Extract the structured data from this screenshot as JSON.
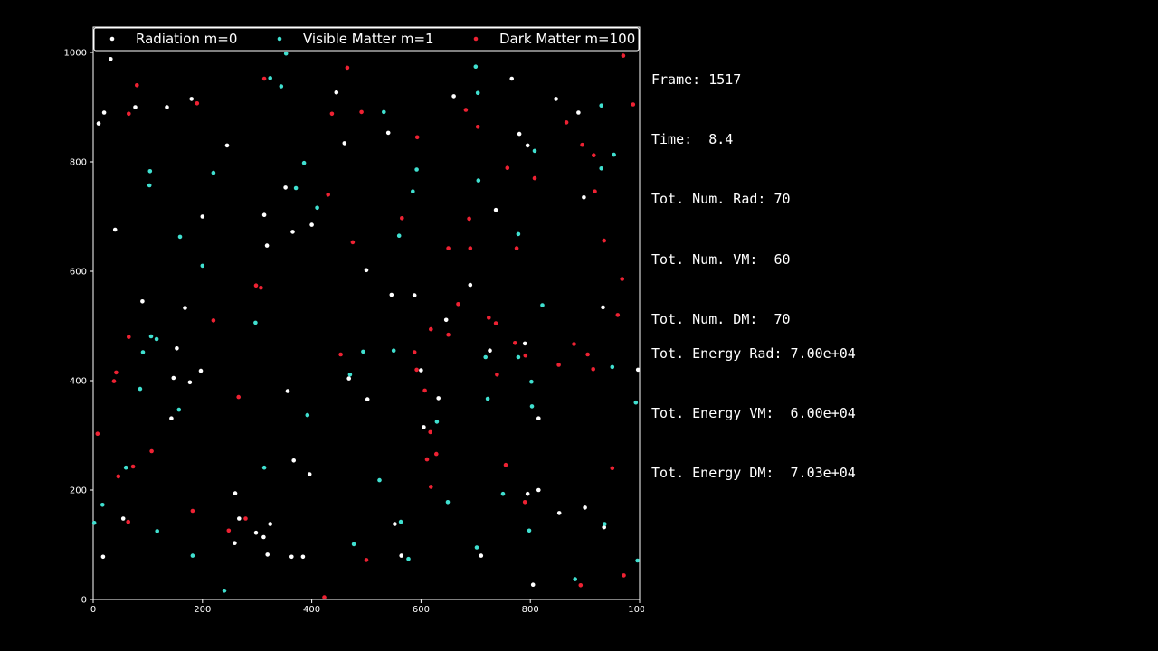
{
  "stats": {
    "frame": "Frame: 1517",
    "time": "Time:  8.4",
    "rad": "Tot. Num. Rad: 70",
    "vm": "Tot. Num. VM:  60",
    "dm": "Tot. Num. DM:  70",
    "energy_rad": "Tot. Energy Rad: 7.00e+04",
    "energy_vm": "Tot. Energy VM:  6.00e+04",
    "energy_dm": "Tot. Energy DM:  7.03e+04"
  },
  "chart_data": {
    "type": "scatter",
    "xlim": [
      0,
      1000
    ],
    "ylim": [
      0,
      1000
    ],
    "xticks": [
      0,
      200,
      400,
      600,
      800,
      1000
    ],
    "yticks": [
      0,
      200,
      400,
      600,
      800,
      1000
    ],
    "grid": false,
    "legend_position": "top",
    "series": [
      {
        "name": "Radiation m=0",
        "color": "#ffffff",
        "points": [
          [
            10,
            870
          ],
          [
            20,
            890
          ],
          [
            32,
            988
          ],
          [
            40,
            676
          ],
          [
            55,
            148
          ],
          [
            18,
            78
          ],
          [
            77,
            900
          ],
          [
            90,
            545
          ],
          [
            135,
            900
          ],
          [
            180,
            915
          ],
          [
            200,
            700
          ],
          [
            245,
            830
          ],
          [
            313,
            703
          ],
          [
            318,
            647
          ],
          [
            352,
            753
          ],
          [
            365,
            672
          ],
          [
            400,
            685
          ],
          [
            445,
            927
          ],
          [
            460,
            834
          ],
          [
            540,
            853
          ],
          [
            500,
            602
          ],
          [
            546,
            557
          ],
          [
            588,
            556
          ],
          [
            660,
            920
          ],
          [
            690,
            575
          ],
          [
            737,
            712
          ],
          [
            766,
            952
          ],
          [
            780,
            851
          ],
          [
            795,
            830
          ],
          [
            847,
            915
          ],
          [
            888,
            890
          ],
          [
            898,
            735
          ],
          [
            168,
            533
          ],
          [
            153,
            459
          ],
          [
            147,
            405
          ],
          [
            177,
            397
          ],
          [
            197,
            418
          ],
          [
            143,
            331
          ],
          [
            356,
            381
          ],
          [
            468,
            404
          ],
          [
            502,
            366
          ],
          [
            600,
            419
          ],
          [
            605,
            315
          ],
          [
            632,
            368
          ],
          [
            646,
            511
          ],
          [
            726,
            455
          ],
          [
            790,
            468
          ],
          [
            815,
            331
          ],
          [
            260,
            194
          ],
          [
            259,
            103
          ],
          [
            267,
            148
          ],
          [
            298,
            122
          ],
          [
            312,
            114
          ],
          [
            324,
            138
          ],
          [
            367,
            254
          ],
          [
            396,
            229
          ],
          [
            319,
            82
          ],
          [
            363,
            78
          ],
          [
            384,
            78
          ],
          [
            552,
            138
          ],
          [
            564,
            80
          ],
          [
            710,
            80
          ],
          [
            795,
            193
          ],
          [
            815,
            200
          ],
          [
            853,
            158
          ],
          [
            900,
            168
          ],
          [
            933,
            534
          ],
          [
            935,
            132
          ],
          [
            997,
            420
          ],
          [
            805,
            27
          ]
        ]
      },
      {
        "name": "Visible Matter m=1",
        "color": "#40e0d0",
        "points": [
          [
            2,
            140
          ],
          [
            17,
            173
          ],
          [
            60,
            241
          ],
          [
            86,
            385
          ],
          [
            91,
            452
          ],
          [
            104,
            783
          ],
          [
            103,
            757
          ],
          [
            106,
            481
          ],
          [
            116,
            476
          ],
          [
            117,
            125
          ],
          [
            157,
            347
          ],
          [
            159,
            663
          ],
          [
            182,
            80
          ],
          [
            200,
            610
          ],
          [
            220,
            780
          ],
          [
            240,
            16
          ],
          [
            297,
            506
          ],
          [
            313,
            241
          ],
          [
            324,
            953
          ],
          [
            344,
            938
          ],
          [
            353,
            998
          ],
          [
            371,
            752
          ],
          [
            386,
            798
          ],
          [
            392,
            337
          ],
          [
            410,
            716
          ],
          [
            470,
            411
          ],
          [
            477,
            101
          ],
          [
            494,
            453
          ],
          [
            524,
            218
          ],
          [
            532,
            891
          ],
          [
            550,
            455
          ],
          [
            560,
            665
          ],
          [
            563,
            142
          ],
          [
            577,
            74
          ],
          [
            585,
            746
          ],
          [
            592,
            786
          ],
          [
            629,
            325
          ],
          [
            649,
            178
          ],
          [
            700,
            974
          ],
          [
            704,
            926
          ],
          [
            702,
            95
          ],
          [
            705,
            766
          ],
          [
            718,
            443
          ],
          [
            722,
            367
          ],
          [
            750,
            193
          ],
          [
            778,
            668
          ],
          [
            778,
            443
          ],
          [
            798,
            126
          ],
          [
            802,
            398
          ],
          [
            803,
            353
          ],
          [
            808,
            820
          ],
          [
            822,
            538
          ],
          [
            882,
            37
          ],
          [
            930,
            903
          ],
          [
            930,
            788
          ],
          [
            936,
            138
          ],
          [
            950,
            425
          ],
          [
            953,
            813
          ],
          [
            993,
            360
          ],
          [
            996,
            71
          ]
        ]
      },
      {
        "name": "Dark Matter m=100",
        "color": "#ee2233",
        "points": [
          [
            8,
            303
          ],
          [
            38,
            399
          ],
          [
            42,
            415
          ],
          [
            46,
            225
          ],
          [
            65,
            480
          ],
          [
            73,
            243
          ],
          [
            80,
            940
          ],
          [
            64,
            142
          ],
          [
            65,
            888
          ],
          [
            107,
            271
          ],
          [
            182,
            162
          ],
          [
            190,
            907
          ],
          [
            220,
            510
          ],
          [
            248,
            126
          ],
          [
            266,
            370
          ],
          [
            279,
            148
          ],
          [
            298,
            574
          ],
          [
            307,
            570
          ],
          [
            313,
            952
          ],
          [
            423,
            4
          ],
          [
            430,
            740
          ],
          [
            437,
            888
          ],
          [
            453,
            448
          ],
          [
            465,
            972
          ],
          [
            475,
            653
          ],
          [
            491,
            891
          ],
          [
            500,
            72
          ],
          [
            565,
            697
          ],
          [
            588,
            452
          ],
          [
            592,
            420
          ],
          [
            593,
            845
          ],
          [
            607,
            382
          ],
          [
            611,
            256
          ],
          [
            617,
            306
          ],
          [
            618,
            206
          ],
          [
            618,
            494
          ],
          [
            628,
            266
          ],
          [
            650,
            642
          ],
          [
            650,
            484
          ],
          [
            668,
            540
          ],
          [
            682,
            895
          ],
          [
            688,
            696
          ],
          [
            690,
            642
          ],
          [
            704,
            864
          ],
          [
            724,
            515
          ],
          [
            737,
            505
          ],
          [
            739,
            411
          ],
          [
            755,
            246
          ],
          [
            758,
            789
          ],
          [
            772,
            469
          ],
          [
            775,
            642
          ],
          [
            790,
            178
          ],
          [
            791,
            446
          ],
          [
            808,
            770
          ],
          [
            852,
            429
          ],
          [
            866,
            872
          ],
          [
            880,
            467
          ],
          [
            892,
            26
          ],
          [
            895,
            831
          ],
          [
            905,
            448
          ],
          [
            915,
            421
          ],
          [
            916,
            812
          ],
          [
            918,
            746
          ],
          [
            935,
            656
          ],
          [
            950,
            240
          ],
          [
            960,
            520
          ],
          [
            968,
            586
          ],
          [
            970,
            994
          ],
          [
            971,
            44
          ],
          [
            988,
            905
          ]
        ]
      }
    ]
  }
}
